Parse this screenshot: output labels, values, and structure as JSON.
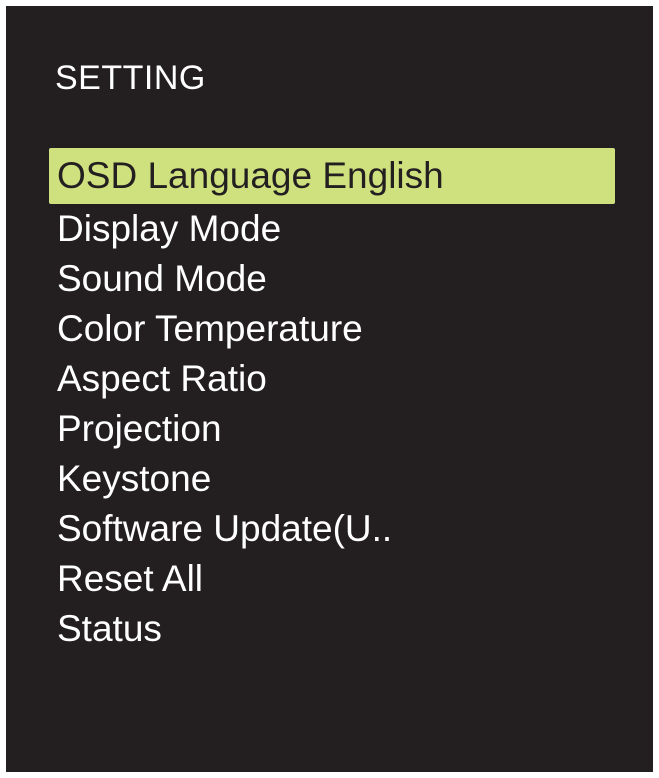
{
  "osd": {
    "title": "SETTING",
    "highlight_color": "#cfe07e",
    "background_color": "#231f20",
    "items": [
      {
        "label": "OSD Language English",
        "selected": true
      },
      {
        "label": "Display Mode",
        "selected": false
      },
      {
        "label": "Sound Mode",
        "selected": false
      },
      {
        "label": "Color Temperature",
        "selected": false
      },
      {
        "label": "Aspect Ratio",
        "selected": false
      },
      {
        "label": "Projection",
        "selected": false
      },
      {
        "label": "Keystone",
        "selected": false
      },
      {
        "label": "Software Update(U..",
        "selected": false
      },
      {
        "label": "Reset All",
        "selected": false
      },
      {
        "label": "Status",
        "selected": false
      }
    ]
  }
}
